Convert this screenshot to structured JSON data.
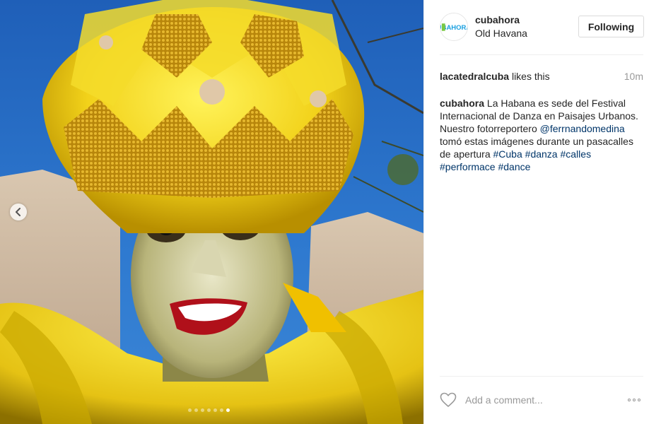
{
  "post": {
    "user": {
      "username": "cubahora",
      "location": "Old Havana",
      "avatar_text": "UBAHORA",
      "avatar_colors": [
        "#1aa0e0",
        "#7ac943",
        "#f2c100"
      ]
    },
    "follow_label": "Following",
    "likes": {
      "liker": "lacatedralcuba",
      "suffix": " likes this"
    },
    "time": "10m",
    "caption": {
      "author": "cubahora",
      "part1": " La Habana es sede del Festival Internacional de Danza en Paisajes Urbanos. Nuestro fotorreportero ",
      "mention": "@ferrnandomedina",
      "part2": " tomó estas imágenes durante un pasacalles de apertura ",
      "tags": [
        "#Cuba",
        "#danza",
        "#calles",
        "#performace",
        "#dance"
      ]
    },
    "comment_placeholder": "Add a comment...",
    "carousel": {
      "total": 7,
      "active_index": 6
    },
    "icons": {
      "prev": "chevron-left-icon",
      "like": "heart-icon",
      "options": "more-options-icon"
    },
    "colors": {
      "link": "#003569",
      "muted": "#999999",
      "border": "#dbdbdb"
    }
  }
}
